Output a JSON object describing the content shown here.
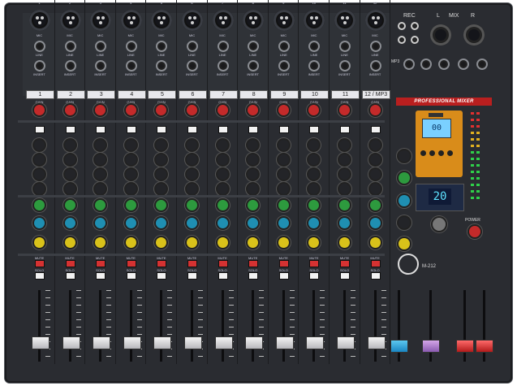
{
  "header": {
    "rec_label": "REC",
    "mix_label": "MIX",
    "mix_l": "L",
    "mix_r": "R",
    "mp3_label": "MP3"
  },
  "channels": [
    {
      "number": "1",
      "scribble": "1"
    },
    {
      "number": "2",
      "scribble": "2"
    },
    {
      "number": "3",
      "scribble": "3"
    },
    {
      "number": "4",
      "scribble": "4"
    },
    {
      "number": "5",
      "scribble": "5"
    },
    {
      "number": "6",
      "scribble": "6"
    },
    {
      "number": "7",
      "scribble": "7"
    },
    {
      "number": "8",
      "scribble": "8"
    },
    {
      "number": "9",
      "scribble": "9"
    },
    {
      "number": "10",
      "scribble": "10"
    },
    {
      "number": "11",
      "scribble": "11"
    },
    {
      "number": "12",
      "scribble": "12 / MP3"
    }
  ],
  "strip_labels": {
    "mic": "MIC",
    "line": "LINE",
    "insert": "INSERT",
    "gain": "GAIN",
    "mute": "MUTE",
    "solo": "SOLO"
  },
  "master": {
    "banner": "PROFESSIONAL MIXER",
    "mp3_display": "00",
    "fx_display": "20",
    "model": "M-212",
    "power_label": "POWER"
  },
  "colors": {
    "panel": "#2a2c31",
    "gain_knob": "#c42a2a",
    "aux1_knob": "#2d9a3e",
    "aux2_knob": "#1f8fb2",
    "pan_knob": "#d9c21a",
    "banner": "#b91f1f",
    "mp3_player": "#d98c1a",
    "fx_digits": "#5ee2ff"
  }
}
